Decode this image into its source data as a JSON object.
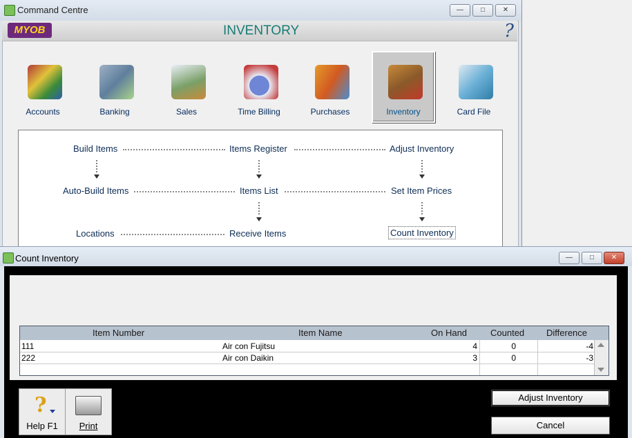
{
  "command_centre": {
    "window_title": "Command Centre",
    "logo": "MYOB",
    "module_title": "INVENTORY",
    "help_glyph": "?",
    "modules": [
      {
        "label": "Accounts",
        "icon": "accounts-icon"
      },
      {
        "label": "Banking",
        "icon": "banking-icon"
      },
      {
        "label": "Sales",
        "icon": "sales-icon"
      },
      {
        "label": "Time Billing",
        "icon": "time-billing-icon"
      },
      {
        "label": "Purchases",
        "icon": "purchases-icon"
      },
      {
        "label": "Inventory",
        "icon": "inventory-icon",
        "selected": true
      },
      {
        "label": "Card File",
        "icon": "card-file-icon"
      }
    ],
    "flow": {
      "build_items": "Build Items",
      "items_register": "Items Register",
      "adjust_inventory": "Adjust Inventory",
      "auto_build_items": "Auto-Build Items",
      "items_list": "Items List",
      "set_item_prices": "Set Item Prices",
      "locations": "Locations",
      "receive_items": "Receive Items",
      "count_inventory": "Count Inventory"
    }
  },
  "count_inventory": {
    "window_title": "Count Inventory",
    "columns": [
      "Item Number",
      "Item Name",
      "On Hand",
      "Counted",
      "Difference"
    ],
    "rows": [
      {
        "item_number": "111",
        "item_name": "Air con Fujitsu",
        "on_hand": "4",
        "counted": "0",
        "difference": "-4"
      },
      {
        "item_number": "222",
        "item_name": "Air con Daikin",
        "on_hand": "3",
        "counted": "0",
        "difference": "-3"
      }
    ],
    "toolbar": {
      "help_label": "Help F1",
      "print_label": "Print"
    },
    "buttons": {
      "adjust_inventory": "Adjust Inventory",
      "cancel": "Cancel"
    }
  },
  "colors": {
    "module_title": "#177b74",
    "logo_bg": "#6d2a7d",
    "logo_text": "#ffd21f"
  }
}
